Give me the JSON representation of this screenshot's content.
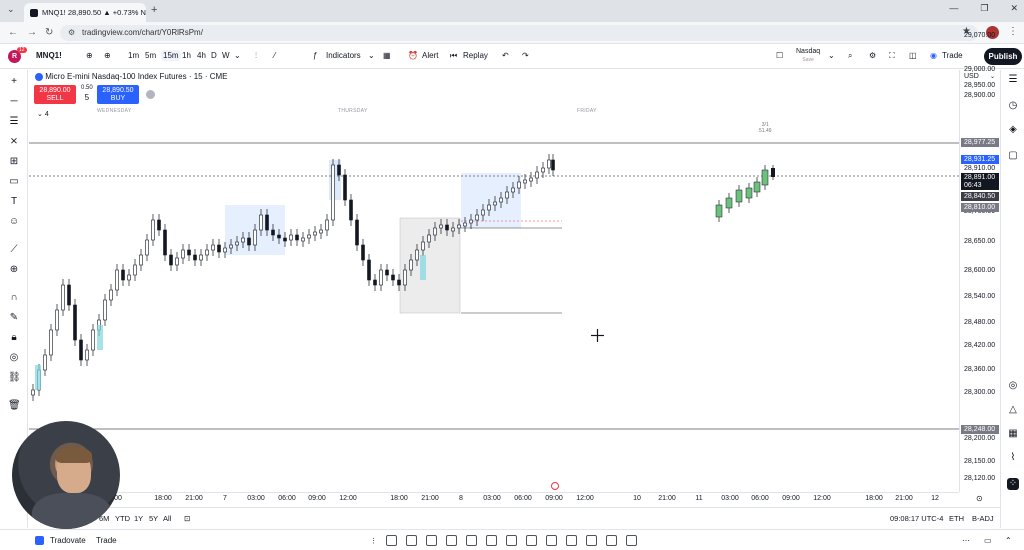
{
  "browser": {
    "tab_title": "MNQ1! 28,890.50 ▲ +0.73% N",
    "url": "tradingview.com/chart/Y0RlRsPm/"
  },
  "toolbar": {
    "avatar_letter": "R",
    "notif_count": "12",
    "symbol": "MNQ1!",
    "timeframes": [
      "1m",
      "5m",
      "15m",
      "1h",
      "4h",
      "D",
      "W"
    ],
    "active_timeframe": "15m",
    "indicators_label": "Indicators",
    "alert_label": "Alert",
    "replay_label": "Replay",
    "layout_name": "Nasdaq",
    "layout_status": "Save",
    "trade_label": "Trade",
    "publish_label": "Publish"
  },
  "legend": {
    "title": "Micro E-mini Nasdaq-100 Index Futures · 15 · CME",
    "sell_price": "28,890.00",
    "sell_label": "SELL",
    "buy_price": "28,890.50",
    "buy_label": "BUY",
    "spread": "0.50",
    "qty": "5",
    "collapsed_count": "4"
  },
  "day_labels": [
    "WEDNESDAY",
    "THURSDAY",
    "FRIDAY"
  ],
  "price_axis": {
    "currency": "USD",
    "labels": [
      "29,070.00",
      "29,000.00",
      "28,950.00",
      "28,900.00",
      "28,800.00",
      "28,750.00",
      "28,700.00",
      "28,650.00",
      "28,600.00",
      "28,540.00",
      "28,480.00",
      "28,420.00",
      "28,360.00",
      "28,300.00",
      "28,200.00",
      "28,150.00",
      "28,120.00"
    ],
    "tags": {
      "ath_label": "ATH",
      "ath_price": "28,977.25",
      "a": "28,931.25",
      "b": "28,910.00",
      "last": "28,891.00",
      "countdown": "06:43",
      "c": "28,840.50",
      "d": "28,810.00",
      "pdl_label": "PDL",
      "pdl_price": "28,248.00",
      "high_note_1": "3/1",
      "high_note_2": "51.49"
    }
  },
  "time_axis": [
    "00",
    "18:00",
    "21:00",
    "7",
    "03:00",
    "06:00",
    "09:00",
    "12:00",
    "18:00",
    "21:00",
    "8",
    "03:00",
    "06:00",
    "09:00",
    "12:00",
    "10",
    "21:00",
    "11",
    "03:00",
    "06:00",
    "09:00",
    "12:00",
    "18:00",
    "21:00",
    "12"
  ],
  "bottom": {
    "ranges": [
      "6M",
      "YTD",
      "1Y",
      "5Y",
      "All"
    ],
    "clock": "09:08:17 UTC-4",
    "session": "ETH",
    "adj": "B-ADJ"
  },
  "broker": {
    "name": "Tradovate",
    "trade": "Trade"
  },
  "colors": {
    "up": "#089981",
    "down": "#131722",
    "sell": "#f23645",
    "buy": "#2962ff",
    "highlight_blue": "#d6e4fb",
    "highlight_gray": "#ececec",
    "current_up": "#6cc17d"
  }
}
